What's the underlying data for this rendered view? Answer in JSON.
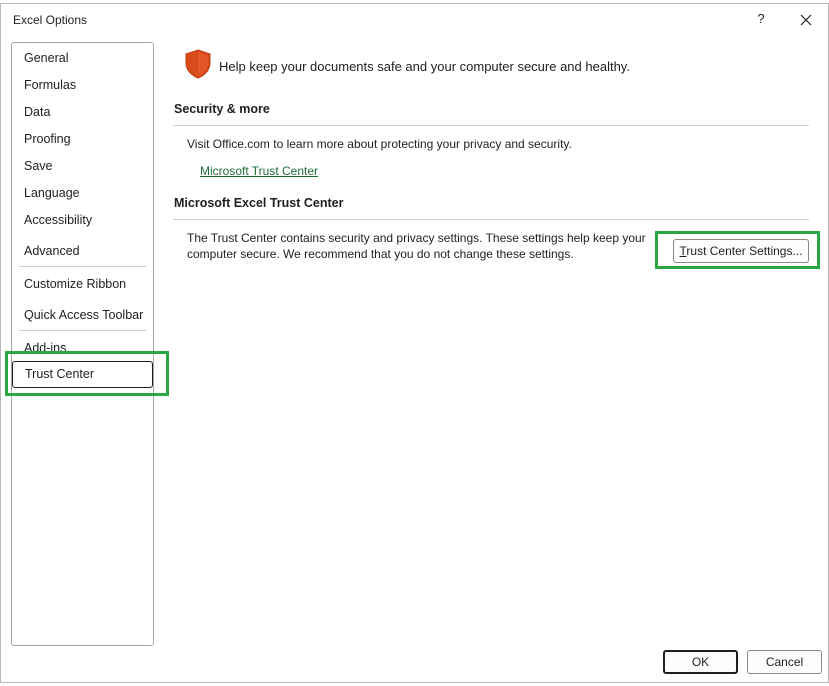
{
  "window": {
    "title": "Excel Options",
    "help_label": "?",
    "close_label": "close"
  },
  "sidebar": {
    "items": [
      {
        "label": "General"
      },
      {
        "label": "Formulas"
      },
      {
        "label": "Data"
      },
      {
        "label": "Proofing"
      },
      {
        "label": "Save"
      },
      {
        "label": "Language"
      },
      {
        "label": "Accessibility"
      },
      {
        "label": "Advanced"
      },
      {
        "label": "Customize Ribbon"
      },
      {
        "label": "Quick Access Toolbar"
      },
      {
        "label": "Add-ins"
      },
      {
        "label": "Trust Center"
      }
    ],
    "selected": "Trust Center"
  },
  "main": {
    "header": "Help keep your documents safe and your computer secure and healthy.",
    "security_section": {
      "title": "Security & more",
      "description": "Visit Office.com to learn more about protecting your privacy and security.",
      "link": "Microsoft Trust Center"
    },
    "trust_center_section": {
      "title": "Microsoft Excel Trust Center",
      "description_line1": "The Trust Center contains security and privacy settings. These settings help keep your",
      "description_line2": "computer secure. We recommend that you do not change these settings.",
      "button_accesskey": "T",
      "button_rest": "rust Center Settings..."
    }
  },
  "footer": {
    "ok_label": "OK",
    "cancel_label": "Cancel"
  },
  "colors": {
    "highlight": "#28a745",
    "link": "#1e6b36",
    "shield": "#d94b1a"
  }
}
